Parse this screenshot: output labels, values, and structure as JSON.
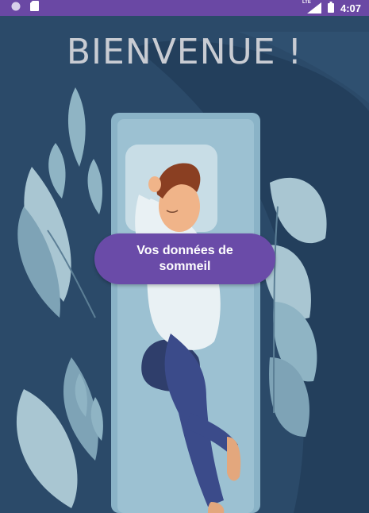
{
  "status_bar": {
    "network": "LTE",
    "time": "4:07",
    "icons": [
      "circle-app-icon",
      "sd-card-icon",
      "lte-signal-icon",
      "battery-icon"
    ],
    "background": "#6a48a4"
  },
  "main": {
    "title": "BIENVENUE !",
    "button_label": "Vos données de\nsommeil",
    "illustration": "person-sleeping-in-bed",
    "colors": {
      "background": "#2a4a6a",
      "accent": "#6a4ba8",
      "title": "#c9ccd3"
    }
  }
}
